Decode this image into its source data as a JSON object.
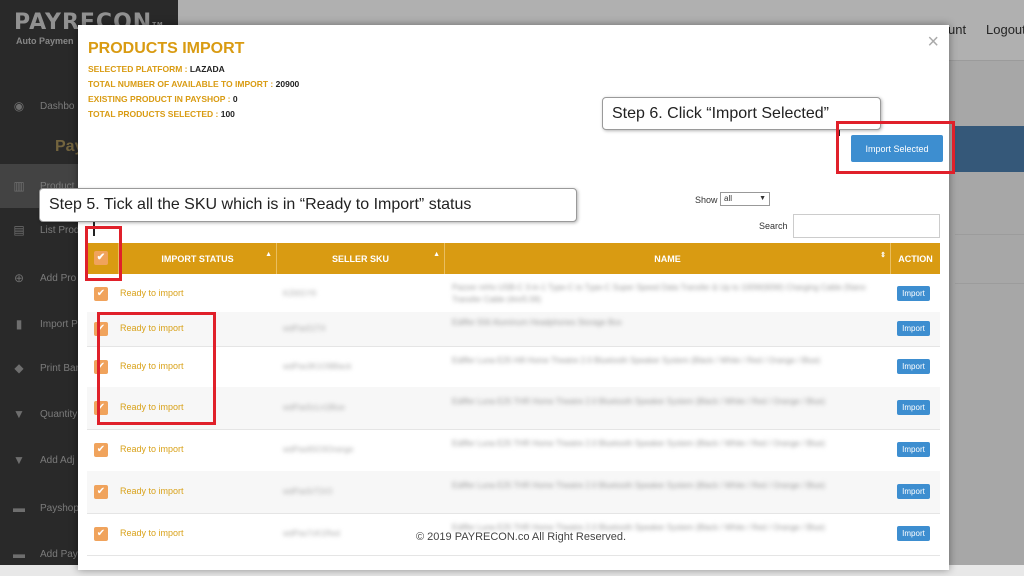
{
  "app": {
    "logo_text": "PAYRECON",
    "logo_suffix": "ᵀᴹ",
    "logo_subtitle": "Auto Paymen",
    "sidebar_brand": "Pay",
    "sidebar": [
      {
        "label": "Dashbo",
        "icon": "palette-icon"
      },
      {
        "label": "Product",
        "icon": "barcode-icon"
      },
      {
        "label": "List Prod",
        "icon": "list-icon"
      },
      {
        "label": "Add Pro",
        "icon": "plus-circle-icon"
      },
      {
        "label": "Import P",
        "icon": "document-icon"
      },
      {
        "label": "Print Bar",
        "icon": "tag-icon"
      },
      {
        "label": "Quantity",
        "icon": "filter-icon"
      },
      {
        "label": "Add Adj",
        "icon": "filter-icon"
      },
      {
        "label": "Payshop",
        "icon": "bank-icon"
      },
      {
        "label": "Add Pay",
        "icon": "bank-icon"
      }
    ],
    "top_links": [
      "unt",
      "Logout"
    ]
  },
  "modal": {
    "title": "PRODUCTS IMPORT",
    "selected_platform_label": "SELECTED PLATFORM :",
    "selected_platform_value": "LAZADA",
    "total_available_label": "TOTAL NUMBER OF AVAILABLE TO IMPORT :",
    "total_available_value": "20900",
    "existing_label": "EXISTING PRODUCT IN PAYSHOP :",
    "existing_value": "0",
    "total_selected_label": "TOTAL PRODUCTS SELECTED :",
    "total_selected_value": "100",
    "close_glyph": "×",
    "import_selected_label": "Import Selected",
    "show_label": "Show",
    "show_value": "all",
    "search_label": "Search",
    "search_value": "",
    "columns": [
      "IMPORT STATUS",
      "SELLER SKU",
      "NAME",
      "ACTION"
    ],
    "check_glyph": "✔",
    "rows": [
      {
        "status": "Ready to import",
        "sku": "K2001Y9",
        "name": "Pazzer mHo USB-C 3-in-1 Type-C to Type-C Super Speed Data Transfer & Up to 100W(60W) Charging Cable (Nano Transfer Cable (4m/5.5ft)",
        "action": "Import"
      },
      {
        "status": "Ready to import",
        "sku": "wdPas51T4",
        "name": "Ediffer 556 Aluminum Headphones Storage Box",
        "action": "Import"
      },
      {
        "status": "Ready to import",
        "sku": "wdPas3K1O9Black",
        "name": "Ediffer Luna E25 Hifi Home Theatre 2.0 Bluetooth Speaker System (Black / White / Red / Orange / Blue)",
        "action": "Import"
      },
      {
        "status": "Ready to import",
        "sku": "wdPas5cLn1Blue",
        "name": "Ediffer Luna E25 THR Home Theatre 2.0 Bluetooth Speaker System (Black / White / Red / Orange / Blue)",
        "action": "Import"
      },
      {
        "status": "Ready to import",
        "sku": "wdPas65O3Orange",
        "name": "Ediffer Luna E25 THR Home Theatre 2.0 Bluetooth Speaker System (Black / White / Red / Orange / Blue)",
        "action": "Import"
      },
      {
        "status": "Ready to import",
        "sku": "wdPas5rT2rO",
        "name": "Ediffer Luna E25 THR Home Theatre 2.0 Bluetooth Speaker System (Black / White / Red / Orange / Blue)",
        "action": "Import"
      },
      {
        "status": "Ready to import",
        "sku": "wdPas7cK1Red",
        "name": "Ediffer Luna E25 THR Home Theatre 2.0 Bluetooth Speaker System (Black / White / Red / Orange / Blue)",
        "action": "Import"
      }
    ],
    "footer": "© 2019 PAYRECON.co All Right Reserved."
  },
  "annotations": {
    "step5": "Step 5. Tick all the SKU which is in “Ready to Import” status",
    "step6": "Step 6. Click “Import Selected”"
  },
  "colors": {
    "accent": "#d99b12",
    "button_blue": "#3d8ed0",
    "checkbox": "#f0a35c",
    "highlight_red": "#e0202a"
  }
}
